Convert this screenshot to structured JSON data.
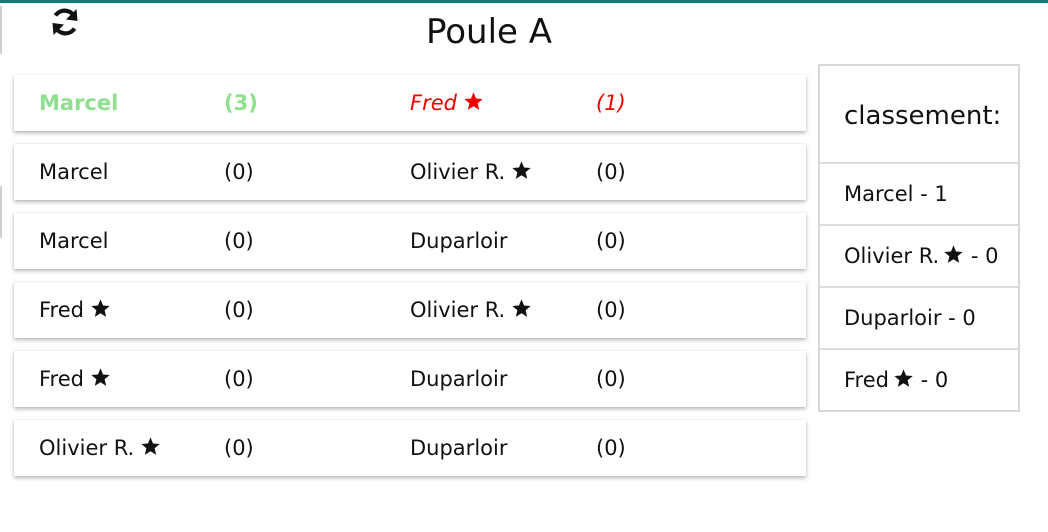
{
  "page": {
    "title": "Poule A",
    "refresh_icon": "refresh-icon",
    "accent": "#0f7a78"
  },
  "colors": {
    "winner": "#8ee08e",
    "loser": "#f20000",
    "star": "#000000"
  },
  "matches": [
    {
      "player1": "Marcel",
      "star1": false,
      "score1": "(3)",
      "player2": "Fred",
      "star2": true,
      "score2": "(1)",
      "played": true
    },
    {
      "player1": "Marcel",
      "star1": false,
      "score1": "(0)",
      "player2": "Olivier R.",
      "star2": true,
      "score2": "(0)",
      "played": false
    },
    {
      "player1": "Marcel",
      "star1": false,
      "score1": "(0)",
      "player2": "Duparloir",
      "star2": false,
      "score2": "(0)",
      "played": false
    },
    {
      "player1": "Fred",
      "star1": true,
      "score1": "(0)",
      "player2": "Olivier R.",
      "star2": true,
      "score2": "(0)",
      "played": false
    },
    {
      "player1": "Fred",
      "star1": true,
      "score1": "(0)",
      "player2": "Duparloir",
      "star2": false,
      "score2": "(0)",
      "played": false
    },
    {
      "player1": "Olivier R.",
      "star1": true,
      "score1": "(0)",
      "player2": "Duparloir",
      "star2": false,
      "score2": "(0)",
      "played": false
    }
  ],
  "ranking": {
    "header": "classement:",
    "rows": [
      {
        "name": "Marcel",
        "star": false,
        "points": "- 1"
      },
      {
        "name": "Olivier R.",
        "star": true,
        "points": "- 0"
      },
      {
        "name": "Duparloir",
        "star": false,
        "points": "- 0"
      },
      {
        "name": "Fred",
        "star": true,
        "points": "- 0"
      }
    ]
  }
}
